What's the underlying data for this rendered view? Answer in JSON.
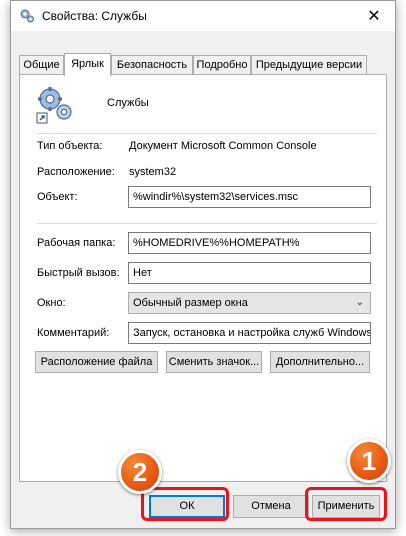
{
  "window": {
    "title": "Свойства: Службы",
    "close_glyph": "✕"
  },
  "tabs": [
    {
      "label": "Общие",
      "active": false
    },
    {
      "label": "Ярлык",
      "active": true
    },
    {
      "label": "Безопасность",
      "active": false
    },
    {
      "label": "Подробно",
      "active": false
    },
    {
      "label": "Предыдущие версии",
      "active": false
    }
  ],
  "shortcut": {
    "name": "Службы",
    "icon": "services-gears-icon",
    "type_label": "Тип объекта:",
    "type_value": "Документ Microsoft Common Console",
    "location_label": "Расположение:",
    "location_value": "system32",
    "target_label": "Объект:",
    "target_value": "%windir%\\system32\\services.msc",
    "start_in_label": "Рабочая папка:",
    "start_in_value": "%HOMEDRIVE%%HOMEPATH%",
    "hotkey_label": "Быстрый вызов:",
    "hotkey_value": "Нет",
    "run_label": "Окно:",
    "run_value": "Обычный размер окна",
    "comment_label": "Комментарий:",
    "comment_value": "Запуск, остановка и настройка служб Windows"
  },
  "actions": {
    "open_location": "Расположение файла",
    "change_icon": "Сменить значок...",
    "advanced": "Дополнительно..."
  },
  "footer": {
    "ok": "ОК",
    "cancel": "Отмена",
    "apply": "Применить"
  },
  "annotations": {
    "step_1": "1",
    "step_2": "2",
    "highlight_color": "#e8141a",
    "badge_color": "#e85b14"
  }
}
